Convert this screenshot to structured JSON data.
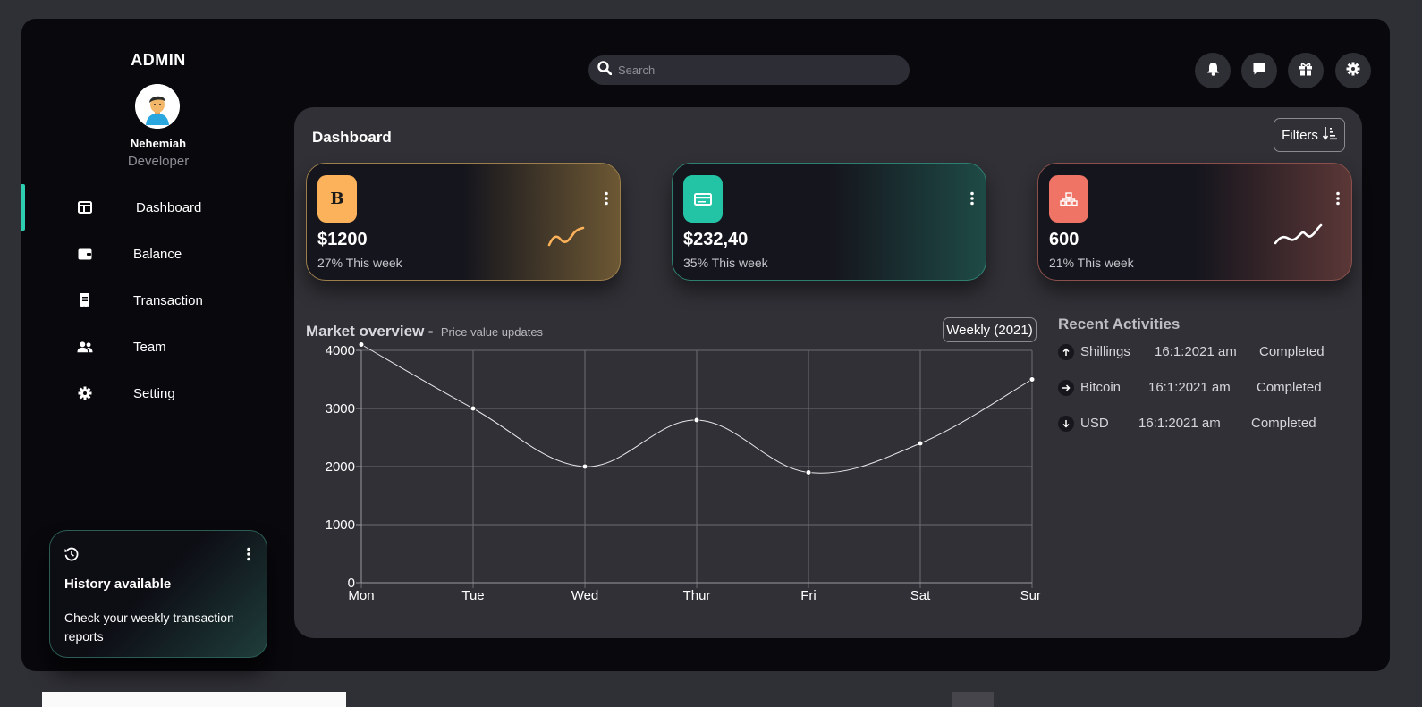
{
  "brand": "ADMIN",
  "user": {
    "name": "Nehemiah",
    "role": "Developer"
  },
  "nav": [
    {
      "label": "Dashboard",
      "icon": "layout-icon",
      "active": true
    },
    {
      "label": "Balance",
      "icon": "wallet-icon"
    },
    {
      "label": "Transaction",
      "icon": "receipt-icon"
    },
    {
      "label": "Team",
      "icon": "users-icon"
    },
    {
      "label": "Setting",
      "icon": "gear-icon"
    }
  ],
  "history": {
    "title": "History available",
    "description": "Check your weekly transaction reports"
  },
  "search": {
    "placeholder": "Search"
  },
  "topbar": [
    "bell-icon",
    "chat-icon",
    "gift-icon",
    "gear-icon"
  ],
  "page": {
    "title": "Dashboard",
    "filters_label": "Filters"
  },
  "stats": [
    {
      "icon_letter": "B",
      "value": "$1200",
      "sub": "27% This week",
      "accent": "#fbb25a"
    },
    {
      "value": "$232,40",
      "sub": "35% This week",
      "accent": "#23c4a6"
    },
    {
      "value": "600",
      "sub": "21% This week",
      "accent": "#ef7466"
    }
  ],
  "market": {
    "title": "Market overview",
    "separator": "-",
    "subtitle": "Price value updates",
    "period": "Weekly (2021)"
  },
  "chart_data": {
    "type": "line",
    "categories": [
      "Mon",
      "Tue",
      "Wed",
      "Thur",
      "Fri",
      "Sat",
      "Sun"
    ],
    "values": [
      4100,
      3000,
      2000,
      2800,
      1900,
      2400,
      3500
    ],
    "ylim": [
      0,
      4000
    ],
    "yticks": [
      0,
      1000,
      2000,
      3000,
      4000
    ],
    "grid": true,
    "line_color": "#e8e8ec"
  },
  "recent": {
    "title": "Recent Activities",
    "items": [
      {
        "direction": "up",
        "currency": "Shillings",
        "time": "16:1:2021 am",
        "status": "Completed"
      },
      {
        "direction": "right",
        "currency": "Bitcoin",
        "time": "16:1:2021 am",
        "status": "Completed"
      },
      {
        "direction": "down",
        "currency": "USD",
        "time": "16:1:2021 am",
        "status": "Completed"
      }
    ]
  }
}
